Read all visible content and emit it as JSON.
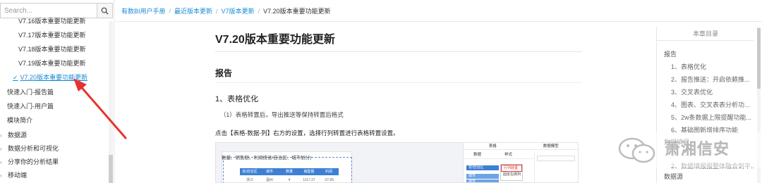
{
  "search": {
    "placeholder": "Search..."
  },
  "sidebar": {
    "items": [
      {
        "label": "V7.16版本重要功能更新",
        "indent": 1,
        "marker": "none"
      },
      {
        "label": "V7.17版本重要功能更新",
        "indent": 1,
        "marker": "none"
      },
      {
        "label": "V7.18版本重要功能更新",
        "indent": 1,
        "marker": "none"
      },
      {
        "label": "V7.19版本重要功能更新",
        "indent": 1,
        "marker": "none"
      },
      {
        "label": "V7.20版本重要功能更新",
        "indent": 1,
        "marker": "check",
        "active": true
      },
      {
        "label": "快速入门-报告篇",
        "indent": 0,
        "marker": "none"
      },
      {
        "label": "快速入门-用户篇",
        "indent": 0,
        "marker": "none"
      },
      {
        "label": "模块简介",
        "indent": 0,
        "marker": "none"
      },
      {
        "label": "数据源",
        "indent": 0,
        "marker": "chevron"
      },
      {
        "label": "数据分析和可视化",
        "indent": 0,
        "marker": "chevron"
      },
      {
        "label": "分享你的分析结果",
        "indent": 0,
        "marker": "chevron"
      },
      {
        "label": "移动端",
        "indent": 0,
        "marker": "chevron"
      }
    ]
  },
  "breadcrumb": {
    "items": [
      "有数BI用户手册",
      "最近版本更新",
      "V7版本更新"
    ],
    "current": "V7.20版本重要功能更新"
  },
  "content": {
    "title": "V7.20版本重要功能更新",
    "section": "报告",
    "subsection": "1、表格优化",
    "para1": "（1）表格转置后，导出推送等保持转置后格式",
    "para2": "点击【表格-数据-列】右方的设置，选择行列转置进行表格转置设置。"
  },
  "shot": {
    "card_title": "数量、销售额、利润按省/自治区、城市划分)",
    "table_headers": [
      "省/自治区",
      "城市",
      "数量",
      "销售额",
      "利润"
    ],
    "table_row": [
      "浙江",
      "温州",
      "4",
      "1117.27",
      "-27.65"
    ],
    "panel_tabs": [
      "表格",
      "数据模型"
    ],
    "sub_tabs": [
      "数据",
      "样式"
    ],
    "menu_items": [
      "行列转置",
      "固定左侧列"
    ],
    "bar1": "省/自治区",
    "bar2": "城市",
    "bar3": "城市"
  },
  "toc": {
    "heading": "本章目录",
    "items": [
      {
        "label": "报告",
        "level": 1
      },
      {
        "label": "1、表格优化",
        "level": 2
      },
      {
        "label": "2、报告推送：开启依赖推...",
        "level": 2
      },
      {
        "label": "3、交叉表优化",
        "level": 2
      },
      {
        "label": "4、图表、交叉表表分析功...",
        "level": 2
      },
      {
        "label": "5、2w条数据上限提醒功能...",
        "level": 2
      },
      {
        "label": "6、基础图新增排序功能",
        "level": 2
      },
      {
        "label": "数据填报",
        "level": 1
      },
      {
        "label": "1、...",
        "level": 2
      },
      {
        "label": "2、数据填报报整体融合到平...",
        "level": 2
      },
      {
        "label": "数据源",
        "level": 1
      }
    ]
  },
  "watermark": {
    "text": "萧湘信安"
  },
  "colors": {
    "link": "#1a8bd6",
    "arrow": "#e8322e",
    "header_blue": "#3d7fd4"
  }
}
